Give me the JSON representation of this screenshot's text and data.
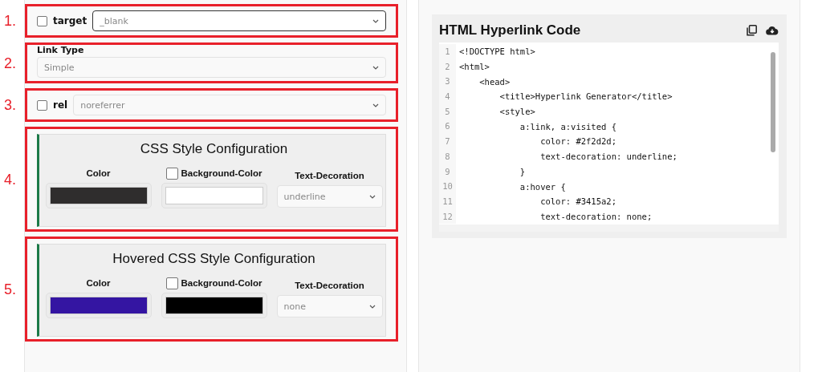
{
  "sections": [
    {
      "kind": "checked_select",
      "marker": "1.",
      "checked": false,
      "label": "target",
      "value": "_blank",
      "focused": true
    },
    {
      "kind": "labeled_select",
      "marker": "2.",
      "label": "Link Type",
      "value": "Simple",
      "focused": false
    },
    {
      "kind": "checked_select",
      "marker": "3.",
      "checked": false,
      "label": "rel",
      "value": "noreferrer",
      "focused": false
    },
    {
      "kind": "style",
      "marker": "4.",
      "title": "CSS Style Configuration",
      "text_color": {
        "label": "Color",
        "color": "#2f2d2d"
      },
      "background": {
        "label": "Background-Color",
        "checked": false,
        "color": "#ffffff"
      },
      "decoration_label": "Text-Decoration",
      "decoration": "underline"
    },
    {
      "kind": "style",
      "marker": "5.",
      "title": "Hovered CSS Style Configuration",
      "text_color": {
        "label": "Color",
        "color": "#3415a2"
      },
      "background": {
        "label": "Background-Color",
        "checked": false,
        "color": "#000000"
      },
      "decoration_label": "Text-Decoration",
      "decoration": "none"
    }
  ],
  "code": {
    "title": "HTML Hyperlink Code",
    "lines": [
      {
        "number": "1",
        "text": "<!DOCTYPE html>"
      },
      {
        "number": "2",
        "text": "<html>"
      },
      {
        "number": "3",
        "text": "    <head>"
      },
      {
        "number": "4",
        "text": "        <title>Hyperlink Generator</title>"
      },
      {
        "number": "5",
        "text": "        <style>"
      },
      {
        "number": "6",
        "text": "            a:link, a:visited {"
      },
      {
        "number": "7",
        "text": "                color: #2f2d2d;"
      },
      {
        "number": "8",
        "text": "                text-decoration: underline;"
      },
      {
        "number": "9",
        "text": "            }"
      },
      {
        "number": "10",
        "text": "            a:hover {"
      },
      {
        "number": "11",
        "text": "                color: #3415a2;"
      },
      {
        "number": "12",
        "text": "                text-decoration: none;"
      }
    ]
  }
}
